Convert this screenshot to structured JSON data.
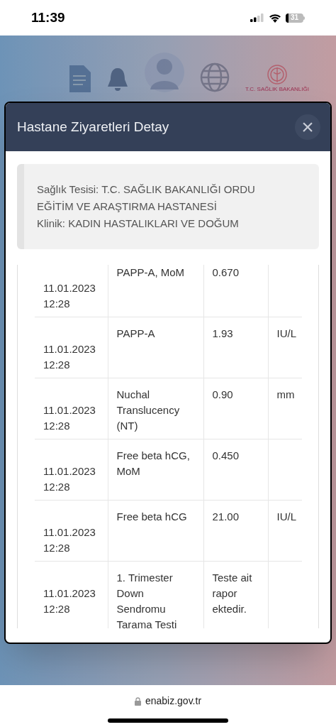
{
  "status_bar": {
    "time": "11:39",
    "battery": "31"
  },
  "background": {
    "logo_caption": "T.C. SAĞLIK BAKANLIĞI"
  },
  "modal": {
    "title": "Hastane Ziyaretleri Detay",
    "close": "×",
    "info": [
      "Sağlık Tesisi: T.C. SAĞLIK BAKANLIĞI ORDU EĞİTİM VE ARAŞTIRMA HASTANESİ",
      "Klinik: KADIN HASTALIKLARI VE DOĞUM"
    ],
    "table": {
      "rows": [
        {
          "date": "11.01.2023 12:28",
          "test": "PAPP-A, MoM",
          "value": "0.670"
        },
        {
          "date": "11.01.2023 12:28",
          "test": "PAPP-A",
          "value": "1.93",
          "unit": "IU/L"
        },
        {
          "date": "11.01.2023 12:28",
          "test": "Nuchal Translucency (NT)",
          "value": "0.90",
          "unit": "mm"
        },
        {
          "date": "11.01.2023 12:28",
          "test": "Free beta hCG, MoM",
          "value": "0.450"
        },
        {
          "date": "11.01.2023 12:28",
          "test": "Free beta hCG",
          "value": "21.00",
          "unit": "IU/L"
        },
        {
          "date": "11.01.2023 12:28",
          "test": "1. Trimester Down Sendromu Tarama Testi",
          "value": "Teste ait rapor ektedir."
        }
      ]
    }
  },
  "browser": {
    "url": "enabiz.gov.tr"
  }
}
